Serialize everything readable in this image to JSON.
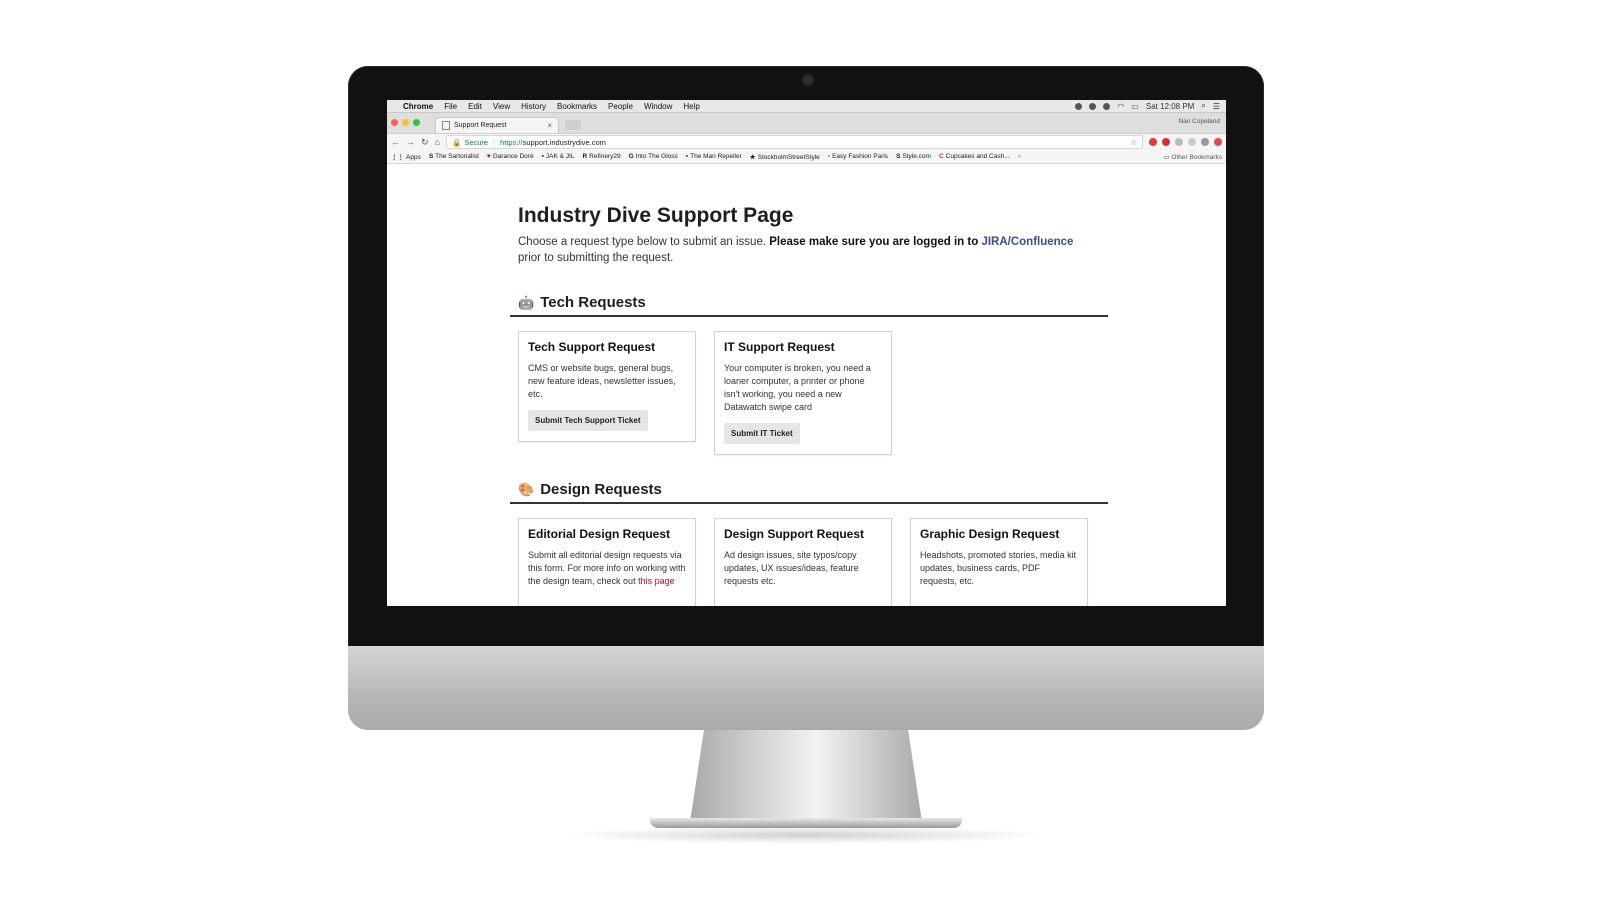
{
  "menubar": {
    "app": "Chrome",
    "items": [
      "File",
      "Edit",
      "View",
      "History",
      "Bookmarks",
      "People",
      "Window",
      "Help"
    ],
    "clock": "Sat 12:08 PM"
  },
  "browser": {
    "tab_title": "Support Request",
    "profile_name": "Nan Copeland",
    "secure_label": "Secure",
    "url_scheme": "https://",
    "url_host": "support.industrydive.com",
    "bookmarks": [
      "Apps",
      "The Sartorialist",
      "Garance Doré",
      "JAK & JIL",
      "Refinery29",
      "Into The Gloss",
      "The Man Repeller",
      "StockholmStreetStyle",
      "Easy Fashion Paris",
      "Style.com",
      "Cupcakes and Cash..."
    ],
    "other_bookmarks": "Other Bookmarks"
  },
  "page": {
    "title": "Industry Dive Support Page",
    "intro_text": "Choose a request type below to submit an issue.",
    "intro_bold": "Please make sure you are logged in to",
    "intro_link": "JIRA/Confluence",
    "intro_end": "prior to submitting the request.",
    "sections": [
      {
        "heading": "Tech Requests",
        "emoji": "🤖",
        "cards": [
          {
            "title": "Tech Support Request",
            "description": "CMS or website bugs, general bugs, new feature ideas, newsletter issues, etc.",
            "button": "Submit Tech Support Ticket"
          },
          {
            "title": "IT Support Request",
            "description": "Your computer is broken, you need a loaner computer, a printer or phone isn't working, you need a new Datawatch swipe card",
            "button": "Submit IT Ticket"
          }
        ]
      },
      {
        "heading": "Design Requests",
        "emoji": "🎨",
        "cards": [
          {
            "title": "Editorial Design Request",
            "description": "Submit all editorial design requests via this form. For more info on working with the design team, check out",
            "link": "this page"
          },
          {
            "title": "Design Support Request",
            "description": "Ad design issues, site typos/copy updates, UX issues/ideas, feature requests etc."
          },
          {
            "title": "Graphic Design Request",
            "description": "Headshots, promoted stories, media kit updates, business cards, PDF requests, etc."
          }
        ]
      }
    ]
  }
}
